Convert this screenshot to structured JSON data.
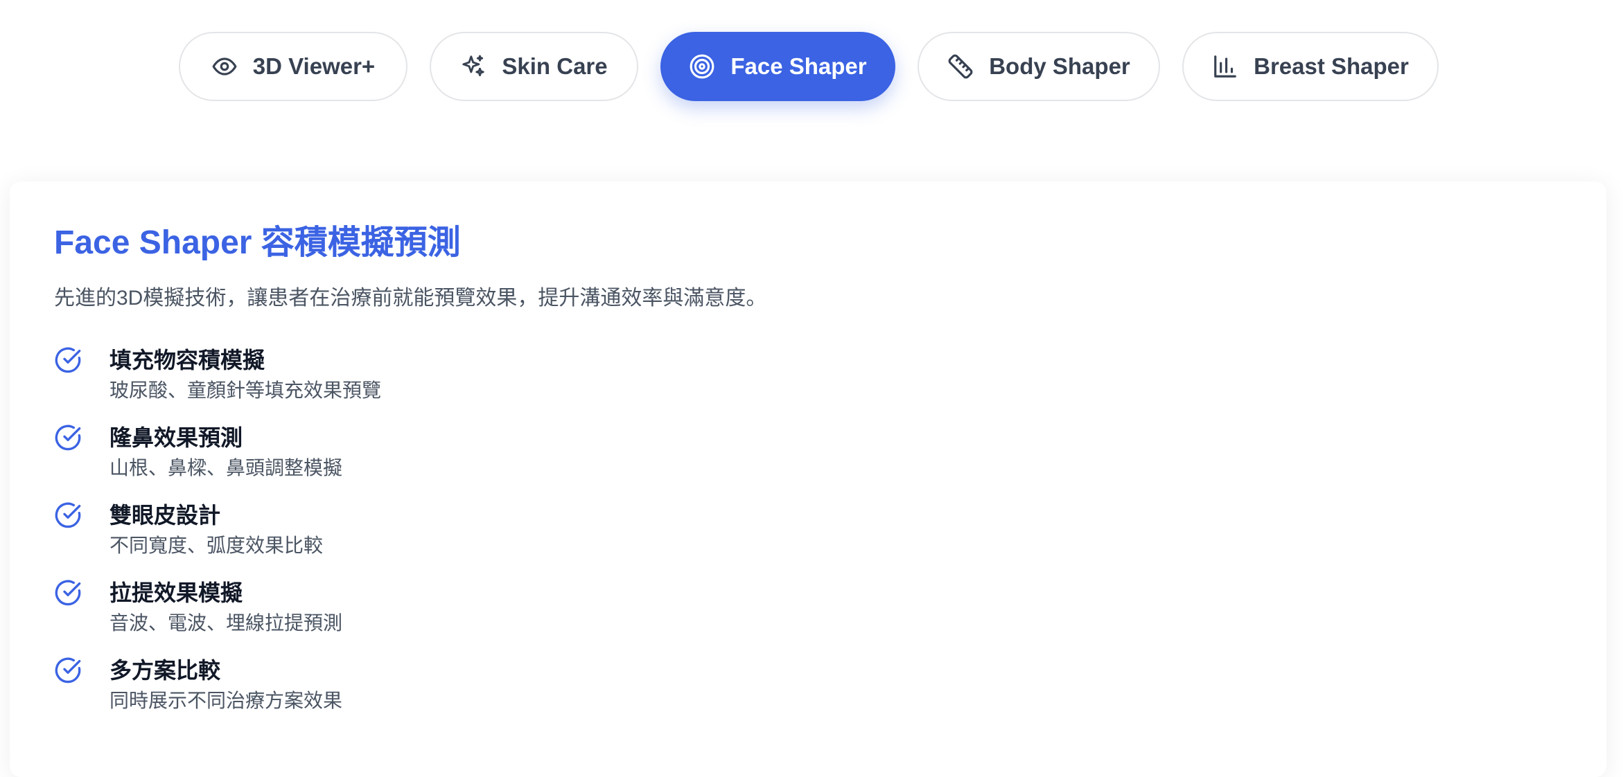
{
  "tabs": [
    {
      "label": "3D Viewer+",
      "icon": "eye-icon",
      "active": false
    },
    {
      "label": "Skin Care",
      "icon": "sparkles-icon",
      "active": false
    },
    {
      "label": "Face Shaper",
      "icon": "target-icon",
      "active": true
    },
    {
      "label": "Body Shaper",
      "icon": "ruler-icon",
      "active": false
    },
    {
      "label": "Breast Shaper",
      "icon": "bar-chart-icon",
      "active": false
    }
  ],
  "panel": {
    "title": "Face Shaper 容積模擬預測",
    "description": "先進的3D模擬技術，讓患者在治療前就能預覽效果，提升溝通效率與滿意度。",
    "features": [
      {
        "title": "填充物容積模擬",
        "desc": "玻尿酸、童顏針等填充效果預覽"
      },
      {
        "title": "隆鼻效果預測",
        "desc": "山根、鼻樑、鼻頭調整模擬"
      },
      {
        "title": "雙眼皮設計",
        "desc": "不同寬度、弧度效果比較"
      },
      {
        "title": "拉提效果模擬",
        "desc": "音波、電波、埋線拉提預測"
      },
      {
        "title": "多方案比較",
        "desc": "同時展示不同治療方案效果"
      }
    ]
  },
  "colors": {
    "accent": "#3b63e3",
    "tab_border": "#e3e5e8",
    "text_primary": "#111827",
    "text_secondary": "#4b5563"
  }
}
